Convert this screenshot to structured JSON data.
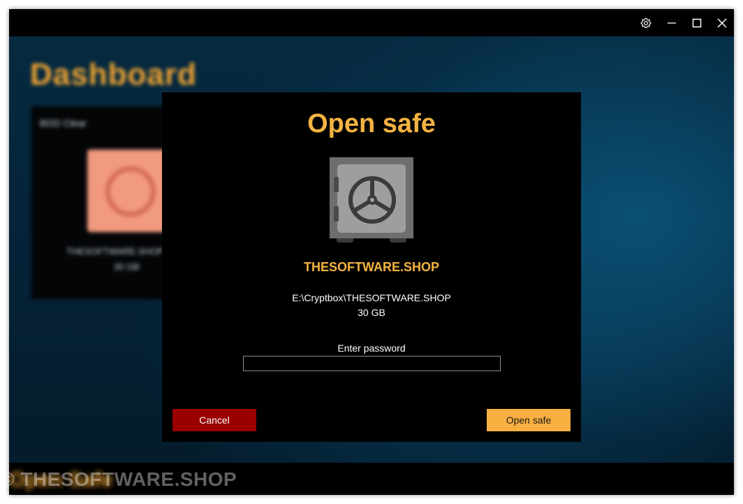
{
  "window": {
    "controls": {
      "settings": "settings-icon",
      "minimize": "minimize-icon",
      "maximize": "maximize-icon",
      "close": "close-icon"
    }
  },
  "background": {
    "dashboard_title": "Dashboard",
    "card": {
      "label": "BDD Clear",
      "name": "THESOFTWARE.SHOP",
      "size": "30 GB"
    },
    "footer_text": "Open Safe"
  },
  "dialog": {
    "title": "Open safe",
    "icon": "safe-icon",
    "safe_name": "THESOFTWARE.SHOP",
    "safe_path": "E:\\Cryptbox\\THESOFTWARE.SHOP",
    "safe_size": "30 GB",
    "password_label": "Enter password",
    "password_value": "",
    "cancel_label": "Cancel",
    "open_label": "Open safe"
  },
  "watermark": "© THESOFTWARE.SHOP",
  "colors": {
    "accent": "#f5b342",
    "cancel": "#9b0000",
    "open_button": "#f9b041"
  }
}
